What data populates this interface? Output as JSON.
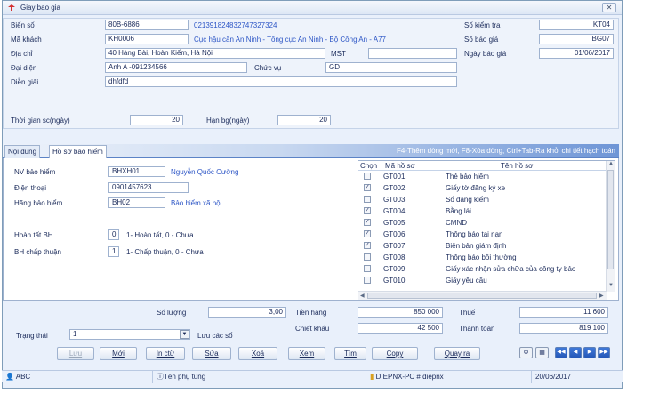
{
  "window": {
    "title": "Giay bao gia",
    "close": "✕"
  },
  "header": {
    "bien_so_label": "Biển số",
    "bien_so": "80B-6886",
    "bien_so_code": "02139182483274732​7324",
    "ma_khach_label": "Mã khách",
    "ma_khach": "KH0006",
    "ma_khach_name": "Cục hậu cần An Ninh - Tổng cục An Ninh - Bộ Công An - A77",
    "dia_chi_label": "Địa chỉ",
    "dia_chi": "40 Hàng Bài, Hoàn Kiếm, Hà Nội",
    "mst_label": "MST",
    "mst": "",
    "dai_dien_label": "Đại diện",
    "dai_dien": "Anh A -091234566",
    "chuc_vu_label": "Chức vụ",
    "chuc_vu": "GD",
    "dien_giai_label": "Diễn giải",
    "dien_giai": "dhfdfd",
    "so_kiem_tra_label": "Số kiểm tra",
    "so_kiem_tra": "KT04",
    "so_bao_gia_label": "Số báo giá",
    "so_bao_gia": "BG07",
    "ngay_bao_gia_label": "Ngày báo giá",
    "ngay_bao_gia": "01/06/2017",
    "thoi_gian_label": "Thời gian sc(ngày)",
    "thoi_gian": "20",
    "han_bg_label": "Hạn bg(ngày)",
    "han_bg": "20"
  },
  "tabs": {
    "items": [
      {
        "label": "Nội dung"
      },
      {
        "label": "Hồ sơ bảo hiểm"
      }
    ],
    "hint": "F4-Thêm dòng mới, F8-Xóa dòng, Ctrl+Tab-Ra khỏi chi tiết hạch toán"
  },
  "insurance": {
    "nv_label": "NV bảo hiểm",
    "nv": "BHXH01",
    "nv_name": "Nguyễn Quốc Cường",
    "dien_thoai_label": "Điện thoại",
    "dien_thoai": "0901457623",
    "hang_label": "Hãng bảo hiểm",
    "hang": "BH02",
    "hang_name": "Bảo hiểm xã hội",
    "hoan_tat_label": "Hoàn tất BH",
    "hoan_tat": "0",
    "hoan_tat_note": "1- Hoàn tất, 0 - Chưa",
    "chap_thuan_label": "BH chấp thuận",
    "chap_thuan": "1",
    "chap_thuan_note": "1- Chấp thuận, 0 - Chưa"
  },
  "docs": {
    "columns": {
      "chon": "Chọn",
      "ma": "Mã hồ sơ",
      "ten": "Tên hồ sơ"
    },
    "rows": [
      {
        "checked": false,
        "code": "GT001",
        "name": "Thẻ bảo hiểm"
      },
      {
        "checked": true,
        "code": "GT002",
        "name": "Giấy tờ đăng ký xe"
      },
      {
        "checked": false,
        "code": "GT003",
        "name": "Sổ đăng kiểm"
      },
      {
        "checked": true,
        "code": "GT004",
        "name": "Bằng lái"
      },
      {
        "checked": true,
        "code": "GT005",
        "name": "CMND"
      },
      {
        "checked": true,
        "code": "GT006",
        "name": "Thông báo tai nạn"
      },
      {
        "checked": true,
        "code": "GT007",
        "name": "Biên bản giám định"
      },
      {
        "checked": false,
        "code": "GT008",
        "name": "Thông báo bồi thường"
      },
      {
        "checked": false,
        "code": "GT009",
        "name": "Giấy xác nhận sửa chữa của công ty bảo"
      },
      {
        "checked": false,
        "code": "GT010",
        "name": "Giấy yêu cầu"
      }
    ]
  },
  "totals": {
    "so_luong_label": "Số lượng",
    "so_luong": "3,00",
    "tien_hang_label": "Tiền hàng",
    "tien_hang": "850 000",
    "thue_label": "Thuế",
    "thue": "11 600",
    "chiet_khau_label": "Chiết khấu",
    "chiet_khau": "42 500",
    "thanh_toan_label": "Thanh toán",
    "thanh_toan": "819 100",
    "trang_thai_label": "Trạng thái",
    "trang_thai": "1",
    "trang_thai_note": "Lưu các sổ"
  },
  "buttons": {
    "luu": "Lưu",
    "moi": "Mới",
    "in_ctu": "In ctừ",
    "sua": "Sửa",
    "xoa": "Xoá",
    "xem": "Xem",
    "tim": "Tìm",
    "copy": "Copy",
    "quay_ra": "Quay ra"
  },
  "status": {
    "user": "ABC",
    "phu_tung": "Tên phụ tùng",
    "machine": "DIEPNX-PC # diepnx",
    "date": "20/06/2017"
  }
}
